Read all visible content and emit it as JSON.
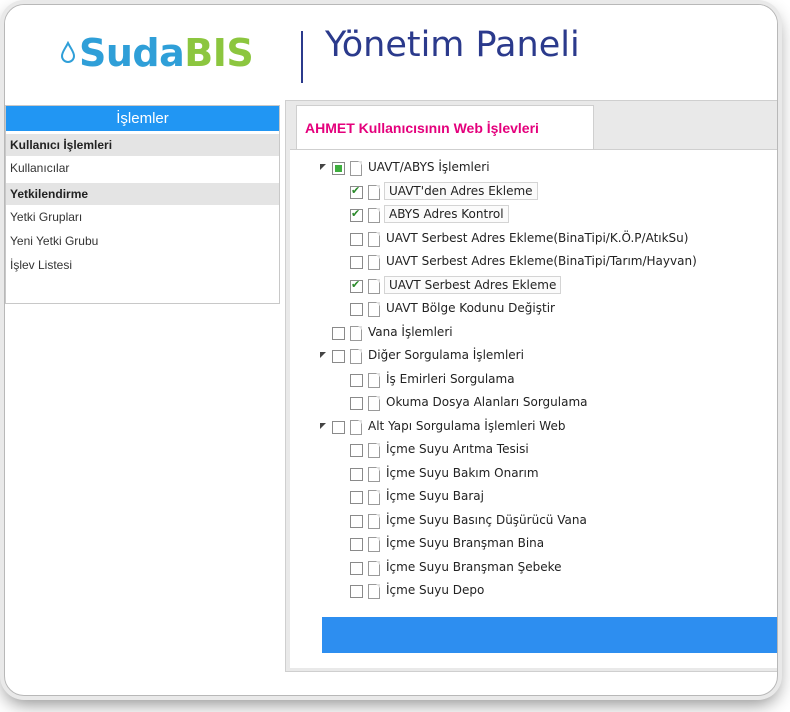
{
  "header": {
    "logo_part1": "SudaBIS_suda",
    "logo": {
      "suda": "Suda",
      "bis": "BIS"
    },
    "title": "Yönetim Paneli"
  },
  "sidebar": {
    "header": "İşlemler",
    "sections": [
      {
        "title": "Kullanıcı İşlemleri",
        "items": [
          "Kullanıcılar"
        ]
      },
      {
        "title": "Yetkilendirme",
        "items": [
          "Yetki Grupları",
          "Yeni Yetki Grubu",
          "İşlev Listesi"
        ]
      }
    ]
  },
  "main": {
    "tab_label": "AHMET Kullanıcısının Web İşlevleri",
    "tree": [
      {
        "label": "UAVT/ABYS İşlemleri",
        "level": 0,
        "expanded": true,
        "state": "partial",
        "selected": false
      },
      {
        "label": "UAVT'den Adres Ekleme",
        "level": 1,
        "state": "checked",
        "selected": true
      },
      {
        "label": "ABYS Adres Kontrol",
        "level": 1,
        "state": "checked",
        "selected": true
      },
      {
        "label": "UAVT Serbest Adres Ekleme(BinaTipi/K.Ö.P/AtıkSu)",
        "level": 1,
        "state": "unchecked",
        "selected": false
      },
      {
        "label": "UAVT Serbest Adres Ekleme(BinaTipi/Tarım/Hayvan)",
        "level": 1,
        "state": "unchecked",
        "selected": false
      },
      {
        "label": "UAVT Serbest Adres Ekleme",
        "level": 1,
        "state": "checked",
        "selected": true
      },
      {
        "label": "UAVT Bölge Kodunu Değiştir",
        "level": 1,
        "state": "unchecked",
        "selected": false
      },
      {
        "label": "Vana İşlemleri",
        "level": 0,
        "expanded": false,
        "state": "unchecked",
        "selected": false
      },
      {
        "label": "Diğer Sorgulama İşlemleri",
        "level": 0,
        "expanded": true,
        "state": "unchecked",
        "selected": false
      },
      {
        "label": "İş Emirleri Sorgulama",
        "level": 1,
        "state": "unchecked",
        "selected": false
      },
      {
        "label": "Okuma Dosya Alanları Sorgulama",
        "level": 1,
        "state": "unchecked",
        "selected": false
      },
      {
        "label": "Alt Yapı Sorgulama İşlemleri Web",
        "level": 0,
        "expanded": true,
        "state": "unchecked",
        "selected": false
      },
      {
        "label": "İçme Suyu Arıtma Tesisi",
        "level": 1,
        "state": "unchecked",
        "selected": false
      },
      {
        "label": "İçme Suyu Bakım Onarım",
        "level": 1,
        "state": "unchecked",
        "selected": false
      },
      {
        "label": "İçme Suyu Baraj",
        "level": 1,
        "state": "unchecked",
        "selected": false
      },
      {
        "label": "İçme Suyu Basınç Düşürücü Vana",
        "level": 1,
        "state": "unchecked",
        "selected": false
      },
      {
        "label": "İçme Suyu Branşman Bina",
        "level": 1,
        "state": "unchecked",
        "selected": false
      },
      {
        "label": "İçme Suyu Branşman Şebeke",
        "level": 1,
        "state": "unchecked",
        "selected": false
      },
      {
        "label": "İçme Suyu Depo",
        "level": 1,
        "state": "unchecked",
        "selected": false
      }
    ]
  },
  "colors": {
    "brand_blue": "#2f9fd8",
    "brand_green": "#8cc63f",
    "title_navy": "#2b3a8c",
    "sidebar_header": "#2196f3",
    "tab_label": "#e4007c",
    "bottom_bar": "#2d8ef0"
  }
}
